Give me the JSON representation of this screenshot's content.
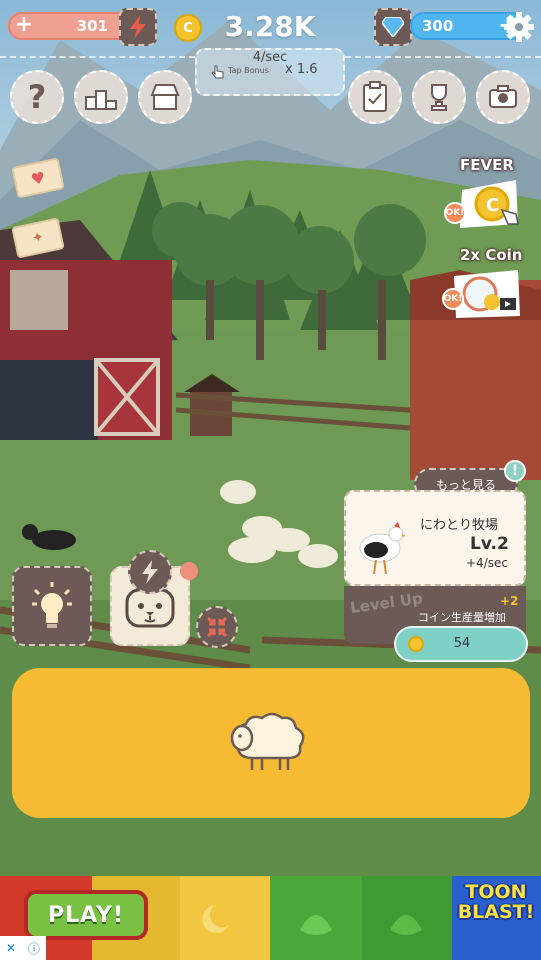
{
  "header": {
    "health_value": "301",
    "coin_total": "3.28K",
    "coin_rate": "4/sec",
    "tap_bonus_label": "Tap Bonus",
    "tap_multiplier": "x 1.6",
    "gem_value": "300"
  },
  "icons": {
    "health": "plus-icon",
    "energy": "lightning-icon",
    "coin": "coin-icon",
    "gem": "diamond-icon",
    "gear": "gear-icon",
    "help": "question-icon",
    "ranking": "podium-icon",
    "shop": "shop-icon",
    "tasks": "clipboard-icon",
    "trophy": "trophy-icon",
    "camera": "camera-icon"
  },
  "bonuses": {
    "fever_label": "FEVER",
    "fever_ok": "OK!",
    "double_coin_label": "2x Coin",
    "double_coin_ok": "OK!"
  },
  "farm_card": {
    "more_label": "もっと見る",
    "alert": "!",
    "name": "にわとり牧場",
    "level": "Lv.2",
    "rate": "+4/sec",
    "levelup_ghost": "Level Up",
    "levelup_plus": "+2",
    "levelup_desc": "コイン生産量増加",
    "cost": "54"
  },
  "ad": {
    "play_label": "PLAY!",
    "brand_line1": "TOON",
    "brand_line2": "BLAST!"
  },
  "colors": {
    "accent_yellow": "#f7bb33",
    "gem_blue": "#4fb6f0",
    "health_red": "#f0a090",
    "teal": "#7fd0c6",
    "panel_brown": "#6b5a55"
  }
}
